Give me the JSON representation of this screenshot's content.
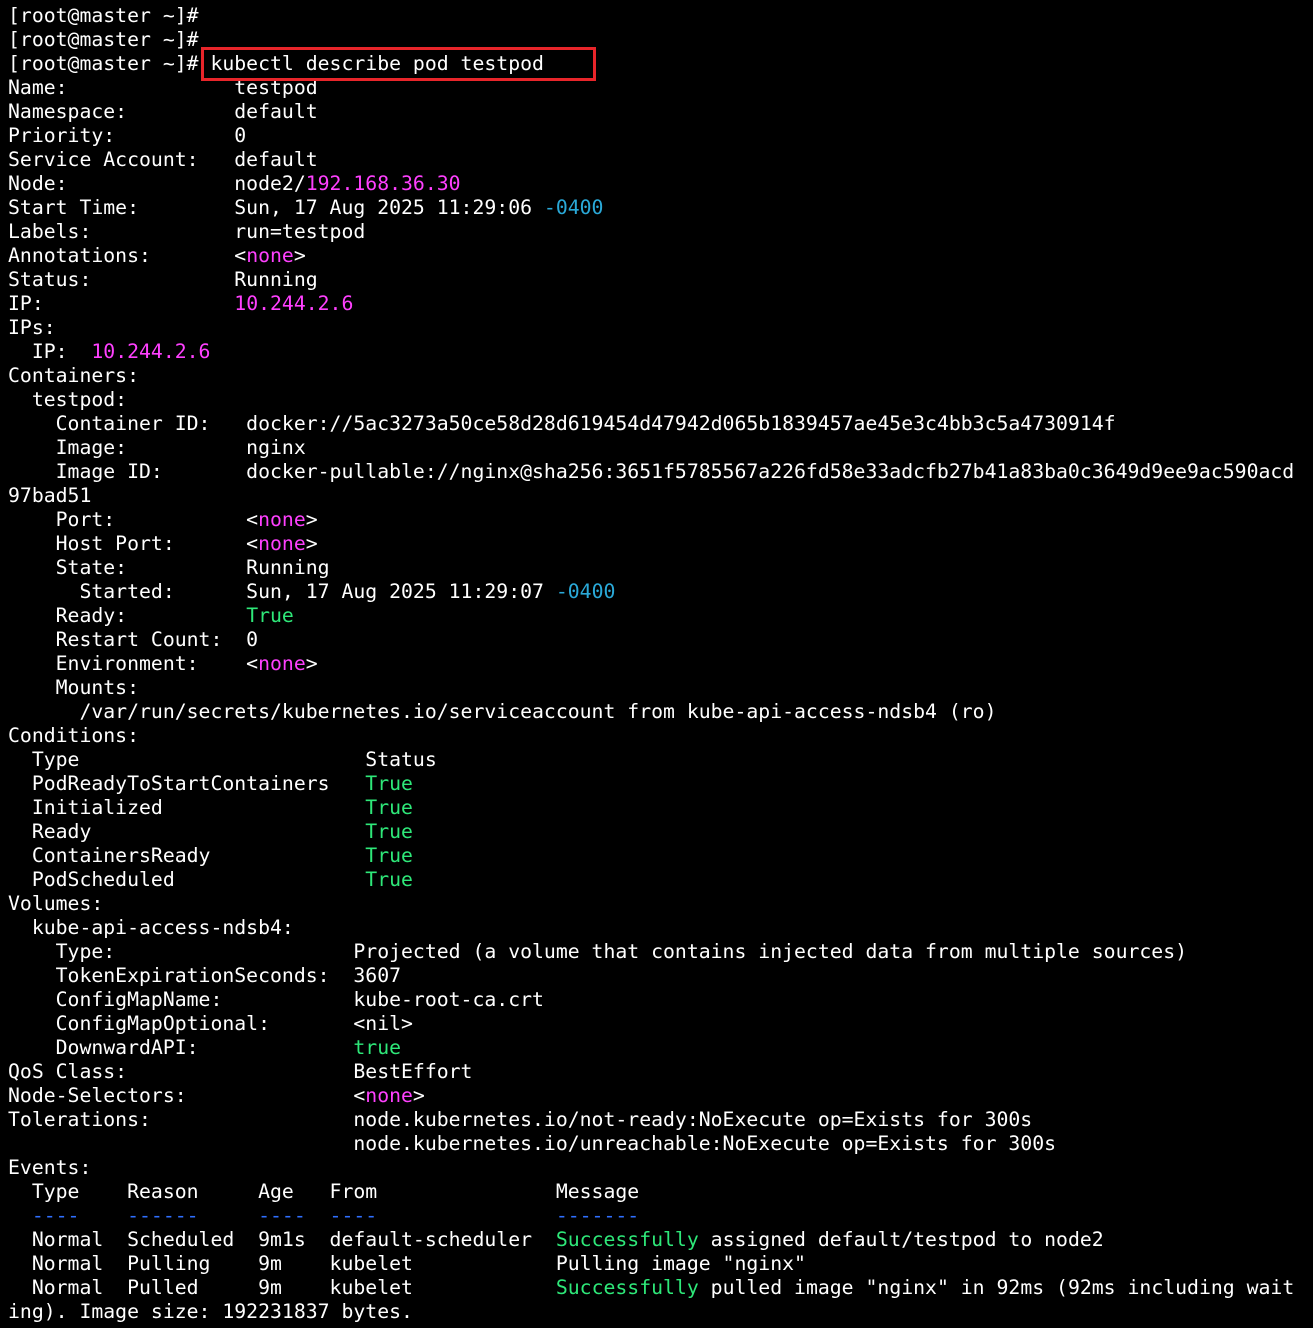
{
  "colors": {
    "background": "#000000",
    "text": "#ffffff",
    "magenta": "#ff40ff",
    "cyan": "#2aa9d8",
    "green": "#2ee879",
    "blue": "#2f6fff",
    "highlight_border": "#e8252a"
  },
  "terminal": {
    "lines": [
      [
        {
          "t": "[root@master ~]#"
        }
      ],
      [
        {
          "t": "[root@master ~]#"
        }
      ],
      [
        {
          "t": "[root@master ~]# kubectl describe pod testpod"
        }
      ],
      [
        {
          "t": "Name:              testpod"
        }
      ],
      [
        {
          "t": "Namespace:         default"
        }
      ],
      [
        {
          "t": "Priority:          0"
        }
      ],
      [
        {
          "t": "Service Account:   default"
        }
      ],
      [
        {
          "t": "Node:              node2/"
        },
        {
          "t": "192.168.36.30",
          "c": "mag"
        }
      ],
      [
        {
          "t": "Start Time:        Sun, 17 Aug 2025 11:29:06 "
        },
        {
          "t": "-0400",
          "c": "cyan"
        }
      ],
      [
        {
          "t": "Labels:            run=testpod"
        }
      ],
      [
        {
          "t": "Annotations:       <"
        },
        {
          "t": "none",
          "c": "mag"
        },
        {
          "t": ">"
        }
      ],
      [
        {
          "t": "Status:            Running"
        }
      ],
      [
        {
          "t": "IP:                "
        },
        {
          "t": "10.244.2.6",
          "c": "mag"
        }
      ],
      [
        {
          "t": "IPs:"
        }
      ],
      [
        {
          "t": "  IP:  "
        },
        {
          "t": "10.244.2.6",
          "c": "mag"
        }
      ],
      [
        {
          "t": "Containers:"
        }
      ],
      [
        {
          "t": "  testpod:"
        }
      ],
      [
        {
          "t": "    Container ID:   docker://5ac3273a50ce58d28d619454d47942d065b1839457ae45e3c4bb3c5a4730914f"
        }
      ],
      [
        {
          "t": "    Image:          nginx"
        }
      ],
      [
        {
          "t": "    Image ID:       docker-pullable://nginx@sha256:3651f5785567a226fd58e33adcfb27b41a83ba0c3649d9ee9ac590acd"
        }
      ],
      [
        {
          "t": "97bad51"
        }
      ],
      [
        {
          "t": "    Port:           <"
        },
        {
          "t": "none",
          "c": "mag"
        },
        {
          "t": ">"
        }
      ],
      [
        {
          "t": "    Host Port:      <"
        },
        {
          "t": "none",
          "c": "mag"
        },
        {
          "t": ">"
        }
      ],
      [
        {
          "t": "    State:          Running"
        }
      ],
      [
        {
          "t": "      Started:      Sun, 17 Aug 2025 11:29:07 "
        },
        {
          "t": "-0400",
          "c": "cyan"
        }
      ],
      [
        {
          "t": "    Ready:          "
        },
        {
          "t": "True",
          "c": "green"
        }
      ],
      [
        {
          "t": "    Restart Count:  0"
        }
      ],
      [
        {
          "t": "    Environment:    <"
        },
        {
          "t": "none",
          "c": "mag"
        },
        {
          "t": ">"
        }
      ],
      [
        {
          "t": "    Mounts:"
        }
      ],
      [
        {
          "t": "      /var/run/secrets/kubernetes.io/serviceaccount from kube-api-access-ndsb4 (ro)"
        }
      ],
      [
        {
          "t": "Conditions:"
        }
      ],
      [
        {
          "t": "  Type                        Status"
        }
      ],
      [
        {
          "t": "  PodReadyToStartContainers   "
        },
        {
          "t": "True",
          "c": "green"
        }
      ],
      [
        {
          "t": "  Initialized                 "
        },
        {
          "t": "True",
          "c": "green"
        }
      ],
      [
        {
          "t": "  Ready                       "
        },
        {
          "t": "True",
          "c": "green"
        }
      ],
      [
        {
          "t": "  ContainersReady             "
        },
        {
          "t": "True",
          "c": "green"
        }
      ],
      [
        {
          "t": "  PodScheduled                "
        },
        {
          "t": "True",
          "c": "green"
        }
      ],
      [
        {
          "t": "Volumes:"
        }
      ],
      [
        {
          "t": "  kube-api-access-ndsb4:"
        }
      ],
      [
        {
          "t": "    Type:                    Projected (a volume that contains injected data from multiple sources)"
        }
      ],
      [
        {
          "t": "    TokenExpirationSeconds:  3607"
        }
      ],
      [
        {
          "t": "    ConfigMapName:           kube-root-ca.crt"
        }
      ],
      [
        {
          "t": "    ConfigMapOptional:       <nil>"
        }
      ],
      [
        {
          "t": "    DownwardAPI:             "
        },
        {
          "t": "true",
          "c": "green"
        }
      ],
      [
        {
          "t": "QoS Class:                   BestEffort"
        }
      ],
      [
        {
          "t": "Node-Selectors:              <"
        },
        {
          "t": "none",
          "c": "mag"
        },
        {
          "t": ">"
        }
      ],
      [
        {
          "t": "Tolerations:                 node.kubernetes.io/not-ready:NoExecute op=Exists for 300s"
        }
      ],
      [
        {
          "t": "                             node.kubernetes.io/unreachable:NoExecute op=Exists for 300s"
        }
      ],
      [
        {
          "t": "Events:"
        }
      ],
      [
        {
          "t": "  Type    Reason     Age   From               Message"
        }
      ],
      [
        {
          "t": "  ----    ------     ----  ----               -------",
          "c": "blue"
        }
      ],
      [
        {
          "t": "  Normal  Scheduled  9m1s  default-scheduler  "
        },
        {
          "t": "Successfully",
          "c": "green"
        },
        {
          "t": " assigned default/testpod to node2"
        }
      ],
      [
        {
          "t": "  Normal  Pulling    9m    kubelet            Pulling image \"nginx\""
        }
      ],
      [
        {
          "t": "  Normal  Pulled     9m    kubelet            "
        },
        {
          "t": "Successfully",
          "c": "green"
        },
        {
          "t": " pulled image \"nginx\" in 92ms (92ms including wait"
        }
      ],
      [
        {
          "t": "ing). Image size: 192231837 bytes."
        }
      ]
    ]
  }
}
